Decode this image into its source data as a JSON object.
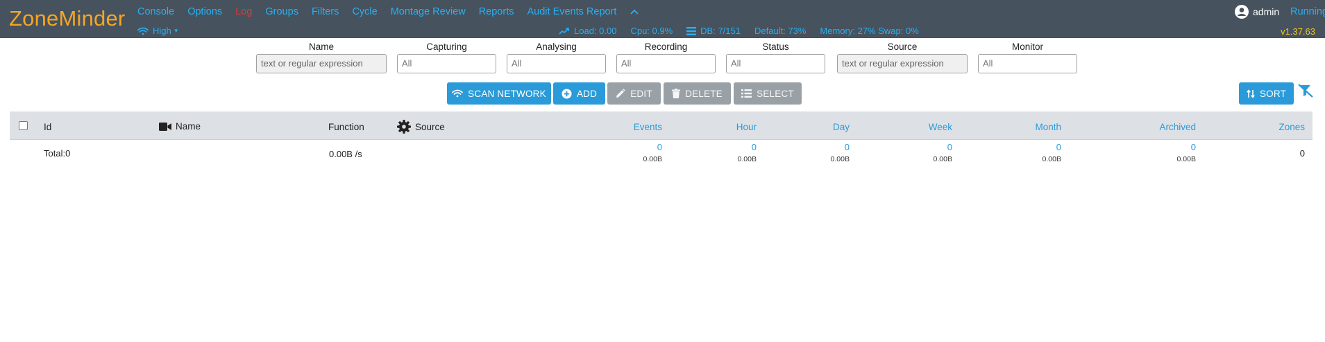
{
  "app": {
    "title": "ZoneMinder",
    "status": "Running",
    "version": "v1.37.63",
    "user": "admin"
  },
  "nav": [
    "Console",
    "Options",
    "Log",
    "Groups",
    "Filters",
    "Cycle",
    "Montage Review",
    "Reports",
    "Audit Events Report"
  ],
  "bandwidth": "High",
  "stats": {
    "load": "Load: 0.00",
    "cpu": "Cpu: 0.9%",
    "db": "DB: 7/151",
    "default": "Default: 73%",
    "memory": "Memory: 27% Swap: 0%"
  },
  "filters": {
    "name": {
      "label": "Name",
      "placeholder": "text or regular expression"
    },
    "capturing": {
      "label": "Capturing",
      "value": "All"
    },
    "analysing": {
      "label": "Analysing",
      "value": "All"
    },
    "recording": {
      "label": "Recording",
      "value": "All"
    },
    "status": {
      "label": "Status",
      "value": "All"
    },
    "source": {
      "label": "Source",
      "placeholder": "text or regular expression"
    },
    "monitor": {
      "label": "Monitor",
      "value": "All"
    }
  },
  "toolbar": {
    "scan": "SCAN NETWORK",
    "add": "ADD",
    "edit": "EDIT",
    "delete": "DELETE",
    "select": "SELECT",
    "sort": "SORT"
  },
  "table": {
    "columns": {
      "id": "Id",
      "name": "Name",
      "function": "Function",
      "source": "Source",
      "events": "Events",
      "hour": "Hour",
      "day": "Day",
      "week": "Week",
      "month": "Month",
      "archived": "Archived",
      "zones": "Zones"
    },
    "total": {
      "label": "Total:0",
      "function": "0.00B /s",
      "events": {
        "count": "0",
        "size": "0.00B"
      },
      "hour": {
        "count": "0",
        "size": "0.00B"
      },
      "day": {
        "count": "0",
        "size": "0.00B"
      },
      "week": {
        "count": "0",
        "size": "0.00B"
      },
      "month": {
        "count": "0",
        "size": "0.00B"
      },
      "archived": {
        "count": "0",
        "size": "0.00B"
      },
      "zones": "0"
    }
  },
  "colors": {
    "header_bg": "#46525e",
    "logo": "#f5a623",
    "link": "#2ab0f2",
    "log_link": "#e53935",
    "primary_button": "#2a9bd8",
    "disabled_button": "#9aa1a6",
    "version": "#f5c518"
  }
}
